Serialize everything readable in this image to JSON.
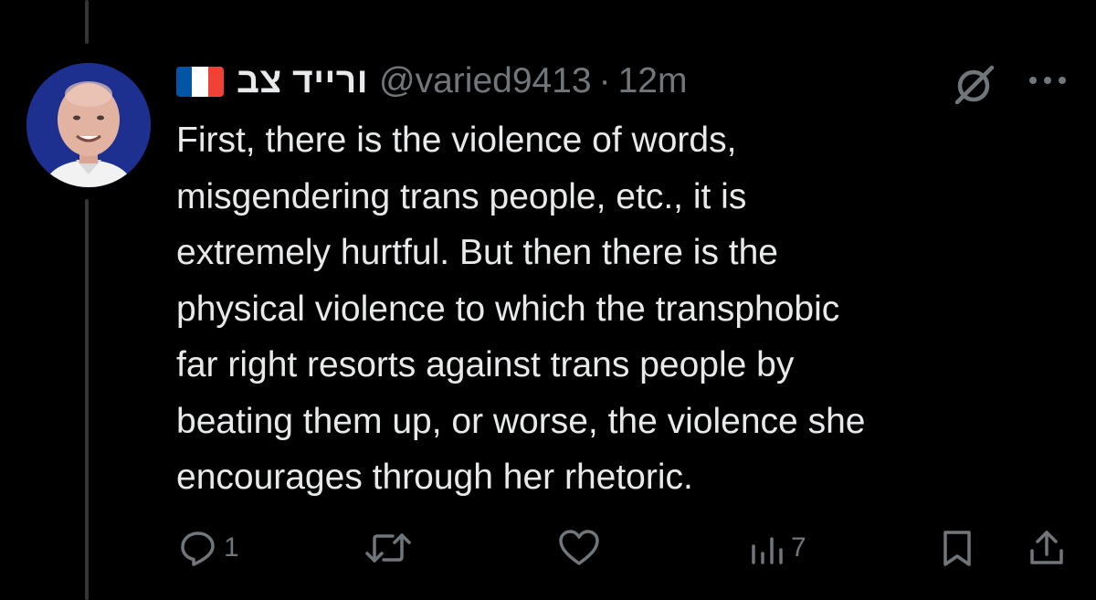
{
  "tweet": {
    "author": {
      "flag_colors": [
        "#0055a4",
        "#ffffff",
        "#ef4135"
      ],
      "display_name": "ורייד צב",
      "handle": "@varied9413",
      "separator": "·",
      "time": "12m"
    },
    "text_lines": [
      "First, there is the violence of words,",
      "misgendering trans people, etc., it is",
      "extremely hurtful. But then there is the",
      "physical violence to which the transphobic",
      "far right resorts against trans people by",
      "beating them up, or worse, the violence she",
      "encourages through her rhetoric."
    ],
    "actions": {
      "reply": {
        "icon": "reply-icon",
        "count": "1"
      },
      "retweet": {
        "icon": "retweet-icon",
        "count": ""
      },
      "like": {
        "icon": "heart-icon",
        "count": ""
      },
      "views": {
        "icon": "views-icon",
        "count": "7"
      },
      "bookmark": {
        "icon": "bookmark-icon"
      },
      "share": {
        "icon": "share-icon"
      }
    },
    "header_icons": [
      "grok-icon",
      "more-icon"
    ]
  },
  "colors": {
    "background": "#000000",
    "text": "#e7e9ea",
    "muted": "#71767b",
    "thread_line": "#333639",
    "avatar_bg": "#1d2f8f"
  }
}
